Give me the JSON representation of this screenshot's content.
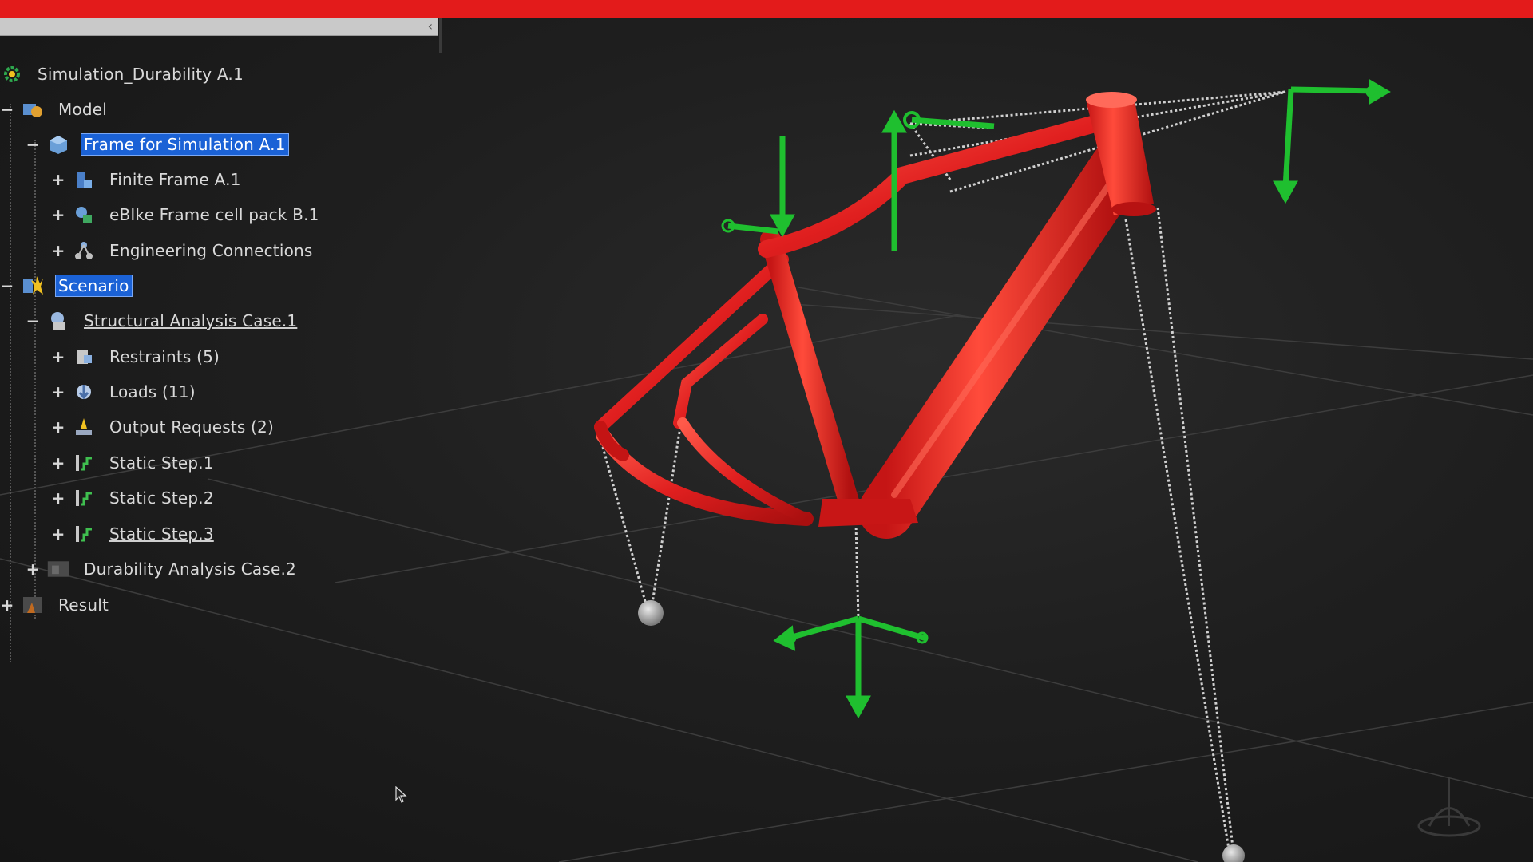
{
  "app": {
    "accent_color": "#e31b1b",
    "selection_color": "#1b62d6"
  },
  "panel": {
    "collapse_icon": "chevron-left-icon",
    "collapse_glyph": "‹"
  },
  "tree": {
    "root": {
      "label": "Simulation_Durability A.1",
      "icon": "simulation-gear-icon"
    },
    "model": {
      "label": "Model",
      "icon": "model-icon",
      "toggle": "−"
    },
    "frame_for_simulation": {
      "label": "Frame for Simulation A.1",
      "icon": "product-cube-icon",
      "toggle": "−"
    },
    "finite_frame": {
      "label": "Finite Frame A.1",
      "icon": "finite-element-icon",
      "toggle": "+"
    },
    "ebike_cell_pack": {
      "label": "eBIke Frame cell pack B.1",
      "icon": "part-icon",
      "toggle": "+"
    },
    "engineering_connections": {
      "label": "Engineering Connections",
      "icon": "connections-icon",
      "toggle": "+"
    },
    "scenario": {
      "label": "Scenario",
      "icon": "scenario-icon",
      "toggle": "−"
    },
    "structural_case": {
      "label": "Structural Analysis Case.1",
      "icon": "analysis-case-icon",
      "toggle": "−"
    },
    "restraints": {
      "label": "Restraints (5)",
      "icon": "restraint-icon",
      "toggle": "+"
    },
    "loads": {
      "label": "Loads (11)",
      "icon": "load-icon",
      "toggle": "+"
    },
    "output_requests": {
      "label": "Output Requests (2)",
      "icon": "output-request-icon",
      "toggle": "+"
    },
    "static_step_1": {
      "label": "Static Step.1",
      "icon": "static-step-icon",
      "toggle": "+"
    },
    "static_step_2": {
      "label": "Static Step.2",
      "icon": "static-step-icon",
      "toggle": "+"
    },
    "static_step_3": {
      "label": "Static Step.3",
      "icon": "static-step-icon",
      "toggle": "+"
    },
    "durability_case": {
      "label": "Durability Analysis Case.2",
      "icon": "durability-case-icon",
      "toggle": "+"
    },
    "result": {
      "label": "Result",
      "icon": "result-icon",
      "toggle": "+"
    }
  },
  "viewport": {
    "model_color": "#e01f1f",
    "boundary_condition_color": "#1fbf2f",
    "frame_name": "eBike frame 3D model"
  }
}
